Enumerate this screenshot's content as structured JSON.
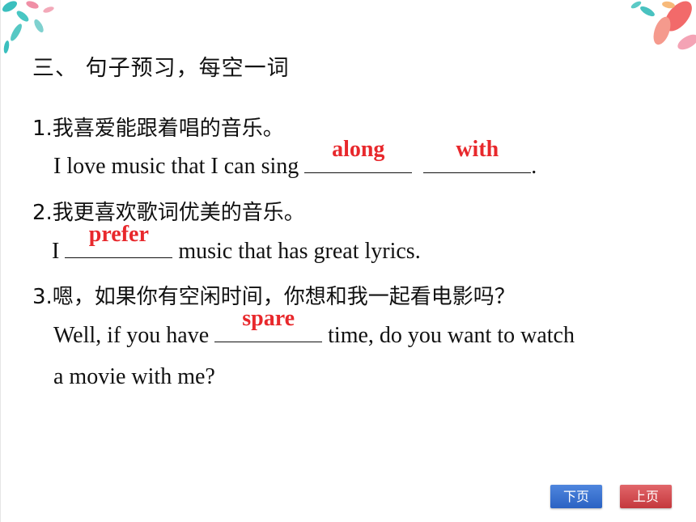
{
  "heading": "三、 句子预习，每空一词",
  "items": [
    {
      "chinese": "1.我喜爱能跟着唱的音乐。",
      "english_before": "I love music that I can sing ",
      "answers": [
        "along",
        "with"
      ],
      "english_after": "."
    },
    {
      "chinese": "2.我更喜欢歌词优美的音乐。",
      "english_before": "I ",
      "answers": [
        "prefer"
      ],
      "english_after": " music that has great lyrics."
    },
    {
      "chinese": "3.嗯，如果你有空闲时间，你想和我一起看电影吗？",
      "english_before": "Well, if you have ",
      "answers": [
        "spare"
      ],
      "english_after": " time, do you want to watch",
      "english_line2": "a movie with me?"
    }
  ],
  "nav": {
    "next_label": "下页",
    "prev_label": "上页"
  },
  "colors": {
    "answer": "#e8282c",
    "next_button": "#3b74d4",
    "prev_button": "#d4474c"
  }
}
